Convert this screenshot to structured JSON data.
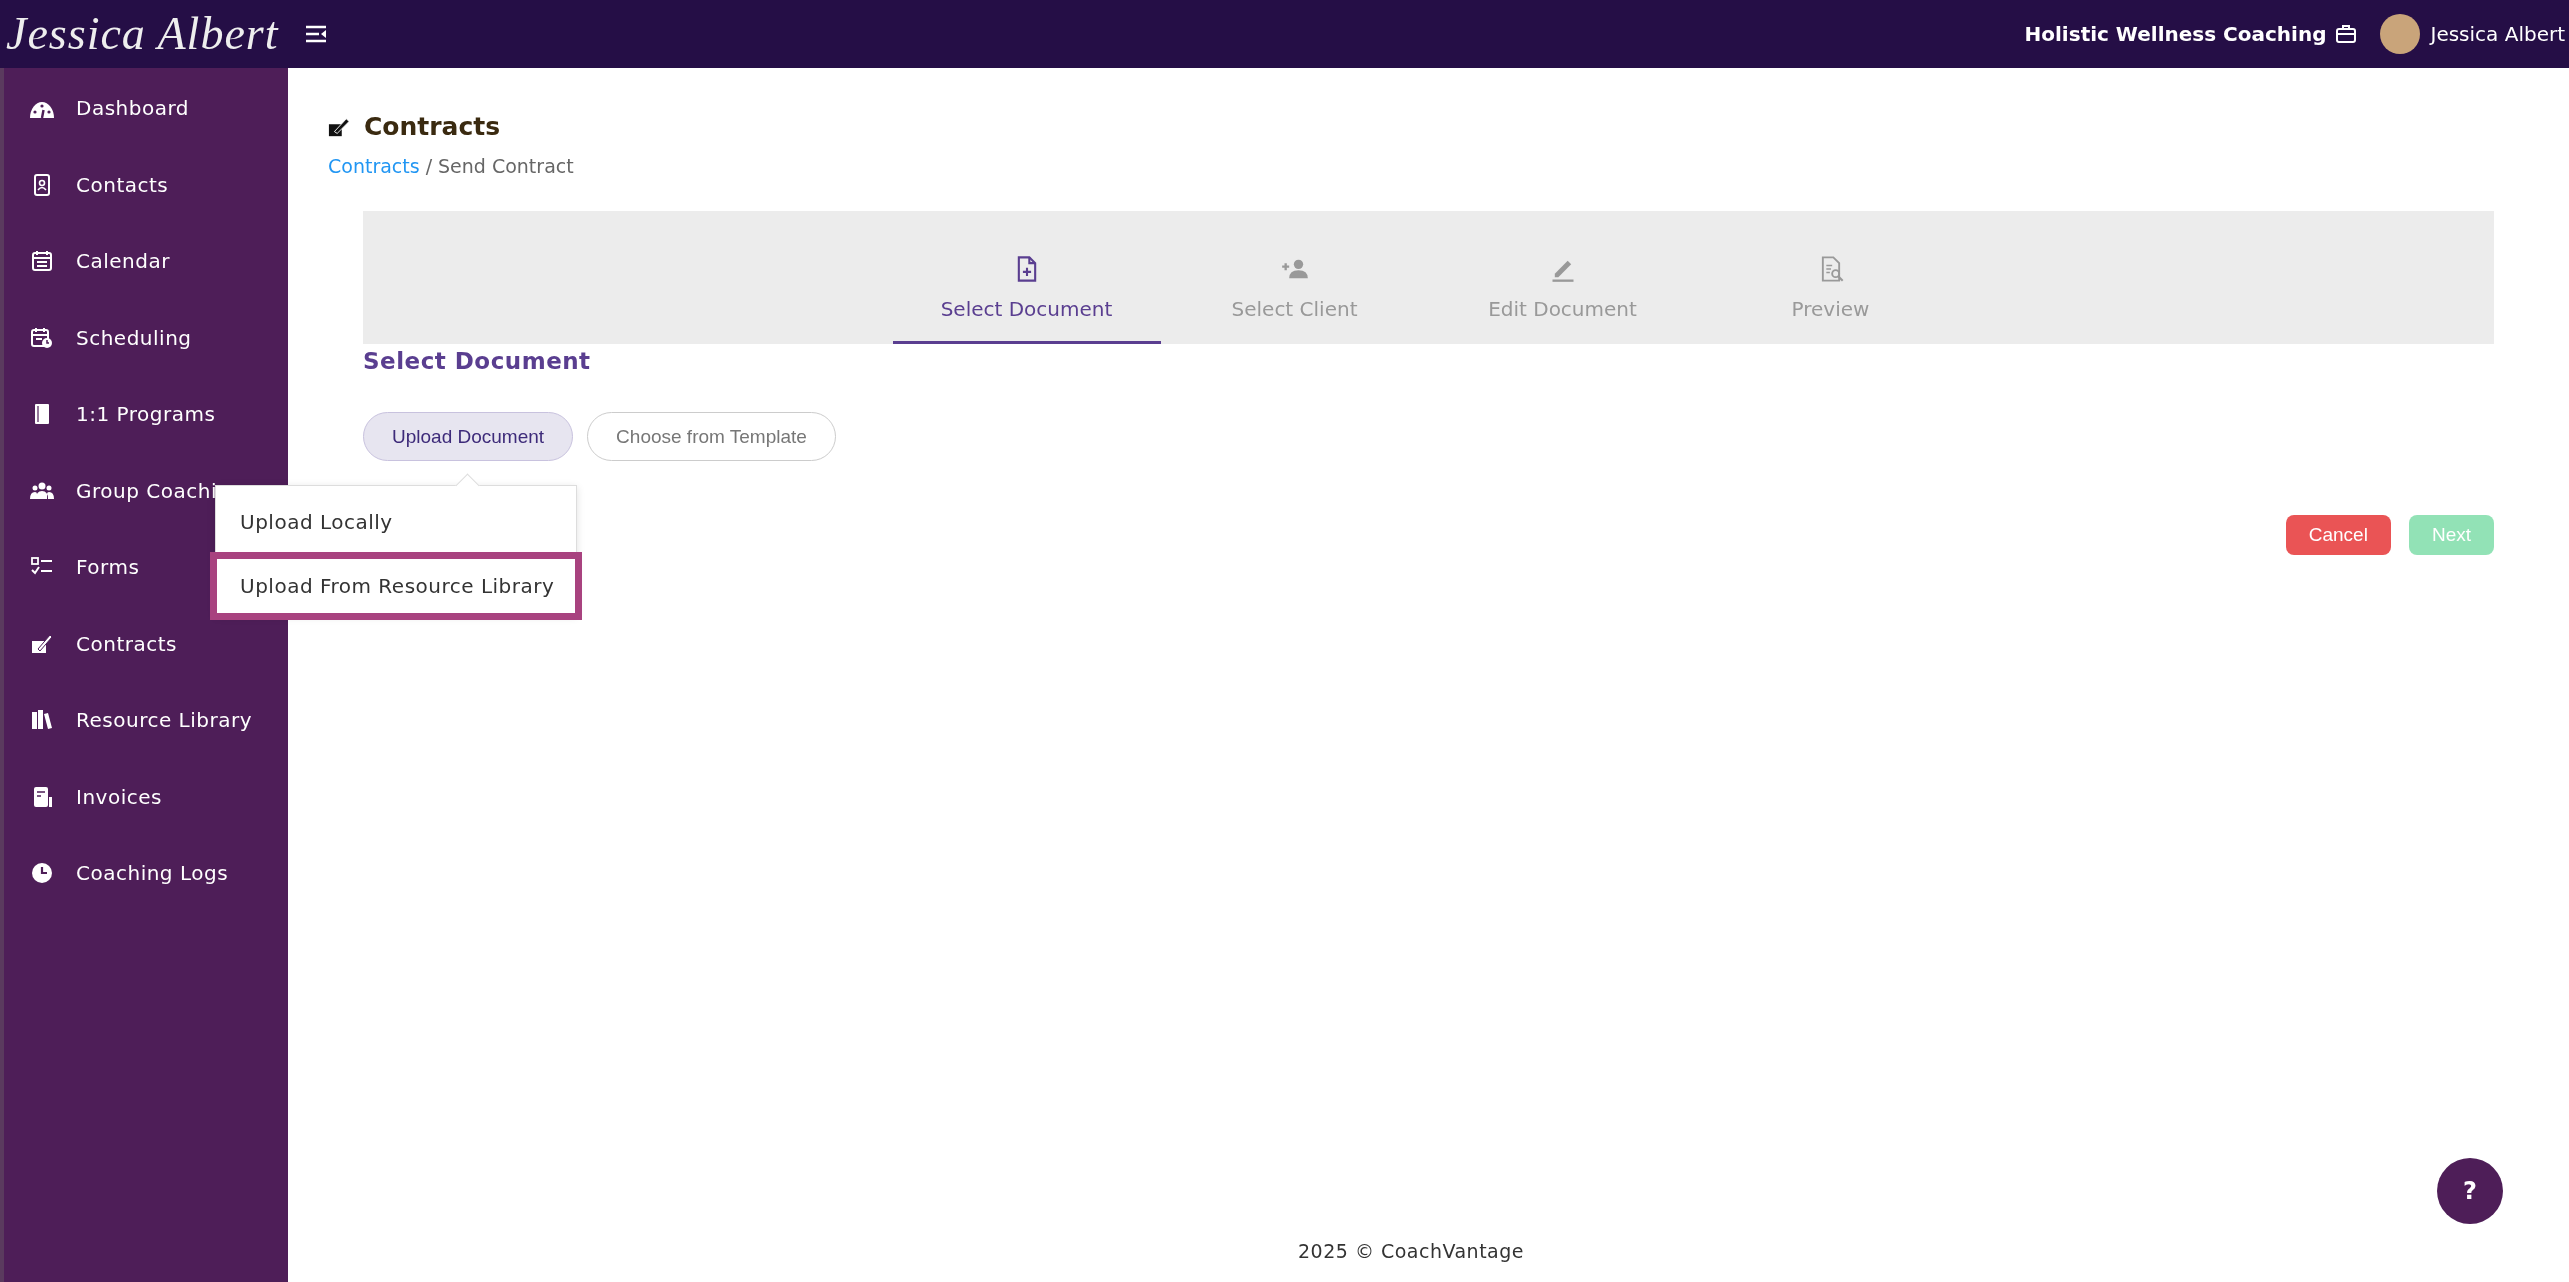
{
  "topbar": {
    "logo": "Jessica Albert",
    "business": "Holistic Wellness Coaching",
    "user": "Jessica Albert"
  },
  "sidebar": {
    "items": [
      {
        "label": "Dashboard",
        "selected": false
      },
      {
        "label": "Contacts",
        "selected": false
      },
      {
        "label": "Calendar",
        "selected": false
      },
      {
        "label": "Scheduling",
        "selected": false
      },
      {
        "label": "1:1 Programs",
        "selected": false
      },
      {
        "label": "Group Coachi",
        "selected": false
      },
      {
        "label": "Forms",
        "selected": false
      },
      {
        "label": "Contracts",
        "selected": false
      },
      {
        "label": "Resource Library",
        "selected": false
      },
      {
        "label": "Invoices",
        "selected": false
      },
      {
        "label": "Coaching Logs",
        "selected": false
      }
    ]
  },
  "page": {
    "title": "Contracts",
    "breadcrumb": {
      "link": "Contracts",
      "separator": "/",
      "current": "Send Contract"
    }
  },
  "steps": [
    {
      "label": "Select Document",
      "selected": true
    },
    {
      "label": "Select Client",
      "selected": false
    },
    {
      "label": "Edit Document",
      "selected": false
    },
    {
      "label": "Preview",
      "selected": false
    }
  ],
  "section_title": "Select Document",
  "source_tabs": [
    {
      "label": "Upload Document",
      "selected": true
    },
    {
      "label": "Choose from Template",
      "selected": false
    }
  ],
  "dropdown": {
    "items": [
      {
        "label": "Upload Locally",
        "highlighted": false
      },
      {
        "label": "Upload From Resource Library",
        "highlighted": true
      }
    ]
  },
  "actions": [
    {
      "label": "Cancel",
      "kind": "danger",
      "disabled": false
    },
    {
      "label": "Next",
      "kind": "success",
      "disabled": true
    }
  ],
  "help": "?",
  "footer": "2025 © CoachVantage"
}
